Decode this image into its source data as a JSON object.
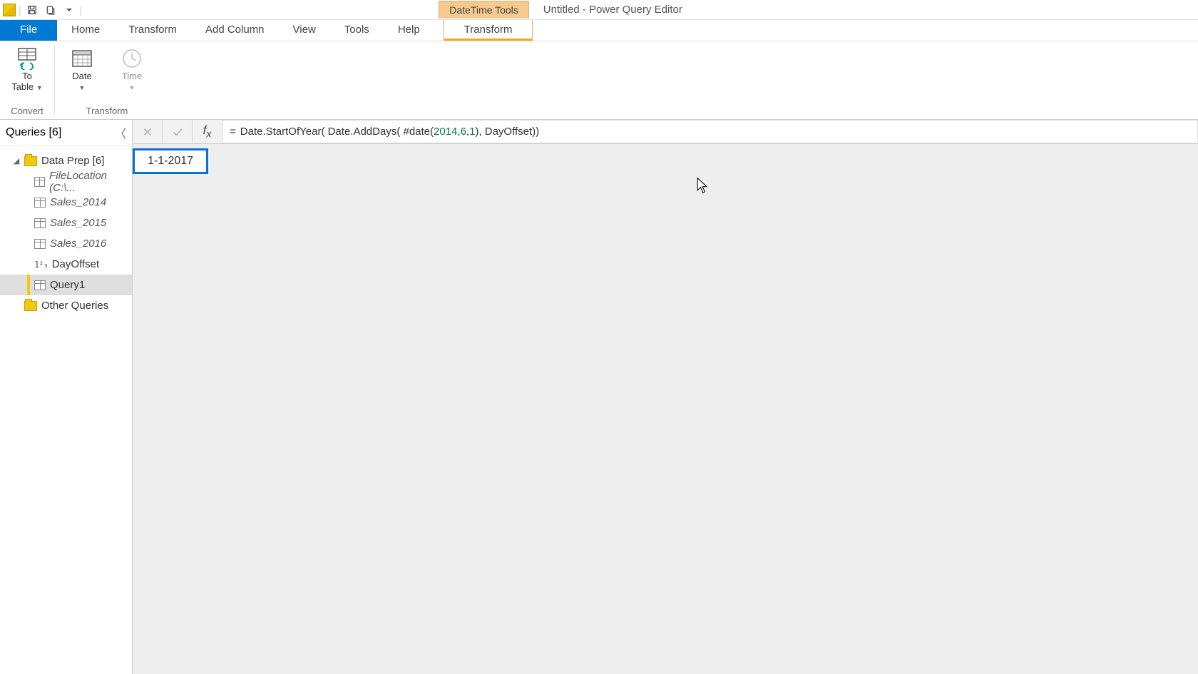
{
  "titlebar": {
    "contextual_tools_label": "DateTime Tools",
    "document_title": "Untitled - Power Query Editor"
  },
  "tabs": {
    "file": "File",
    "home": "Home",
    "transform": "Transform",
    "add_column": "Add Column",
    "view": "View",
    "tools": "Tools",
    "help": "Help",
    "context_transform": "Transform"
  },
  "ribbon": {
    "convert_group": "Convert",
    "transform_group": "Transform",
    "to_table": "To\nTable",
    "date": "Date",
    "time": "Time"
  },
  "queries": {
    "header": "Queries [6]",
    "group1": "Data Prep [6]",
    "items": [
      {
        "label": "FileLocation (C:\\...",
        "kind": "table",
        "italic": true
      },
      {
        "label": "Sales_2014",
        "kind": "table",
        "italic": true
      },
      {
        "label": "Sales_2015",
        "kind": "table",
        "italic": true
      },
      {
        "label": "Sales_2016",
        "kind": "table",
        "italic": true
      },
      {
        "label": "DayOffset",
        "kind": "number",
        "italic": false
      },
      {
        "label": "Query1",
        "kind": "table",
        "italic": false,
        "selected": true
      }
    ],
    "group2": "Other Queries"
  },
  "formula": {
    "prefix": "=",
    "seg1": "Date.StartOfYear( Date.AddDays( #date(",
    "n1": "2014",
    "seg2": ", ",
    "n2": "6",
    "seg3": ",",
    "n3": "1",
    "seg4": "), DayOffset))"
  },
  "result_value": "1-1-2017"
}
